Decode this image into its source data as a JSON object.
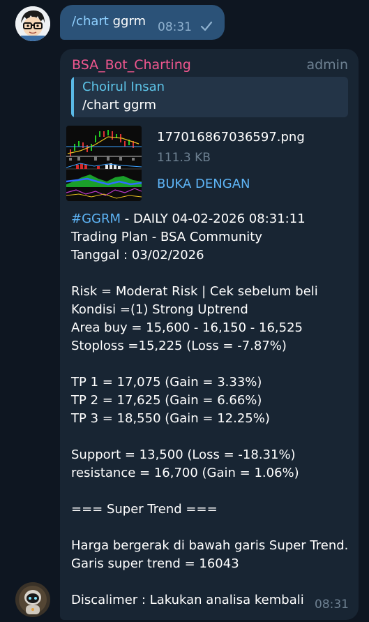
{
  "outgoing": {
    "command": "/chart",
    "argument": " ggrm",
    "time": "08:31",
    "status_icon": "check-icon"
  },
  "incoming": {
    "sender": "BSA_Bot_Charting",
    "role": "admin",
    "reply": {
      "name": "Choirul Insan",
      "text": "/chart ggrm"
    },
    "file": {
      "name": "177016867036597.png",
      "size": "111.3 KB",
      "open_label": "BUKA DENGAN"
    },
    "header": {
      "hashtag": "#GGRM",
      "rest": " - DAILY 04-02-2026 08:31:11"
    },
    "lines": [
      "Trading Plan - BSA Community",
      "Tanggal : 03/02/2026",
      "",
      "Risk = Moderat Risk | Cek sebelum beli",
      "Kondisi =(1) Strong Uptrend",
      "Area buy = 15,600 - 16,150 - 16,525",
      "Stoploss =15,225 (Loss = -7.87%)",
      "",
      "TP 1 = 17,075 (Gain = 3.33%)",
      "TP 2 = 17,625 (Gain = 6.66%)",
      "TP 3 = 18,550 (Gain = 12.25%)",
      "",
      "Support = 13,500 (Loss = -18.31%)",
      "resistance = 16,700 (Gain = 1.06%)",
      "",
      "=== Super Trend ===",
      "",
      "Harga bergerak di bawah garis Super Trend.",
      "Garis super trend = 16043",
      "",
      "Discalimer : Lakukan analisa kembali"
    ],
    "time": "08:31"
  },
  "colors": {
    "background": "#0e1621",
    "outgoing_bubble": "#2b5278",
    "incoming_bubble": "#182533",
    "sender_name": "#f0578f",
    "link": "#5eb5f7",
    "reply_name": "#5dc4e8"
  }
}
